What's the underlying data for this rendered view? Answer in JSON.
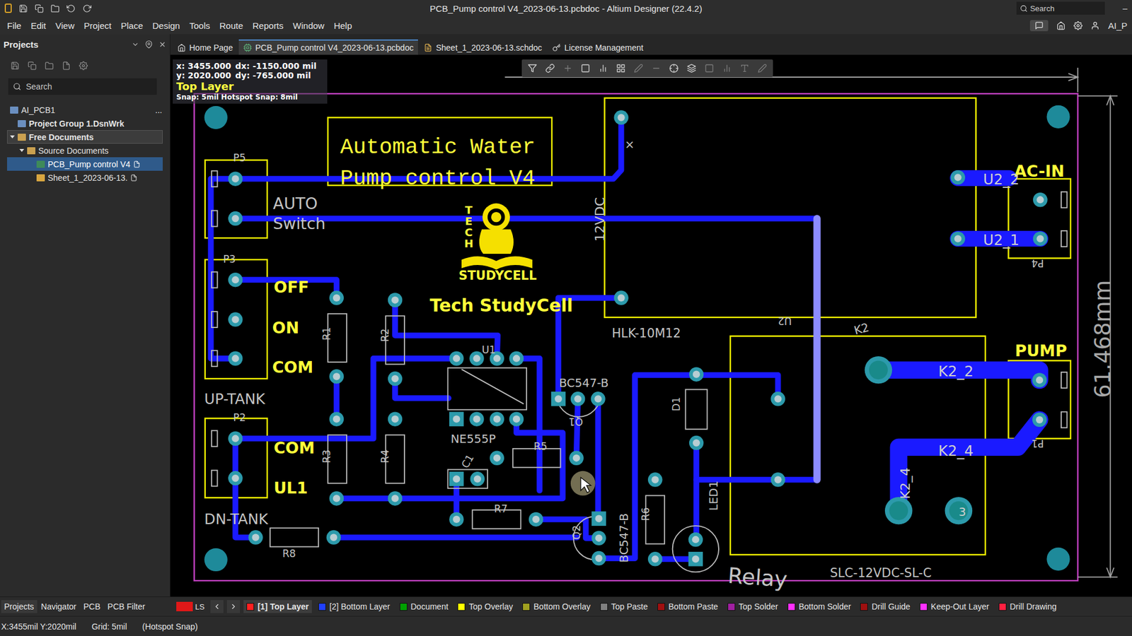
{
  "window": {
    "title": "PCB_Pump control V4_2023-06-13.pcbdoc - Altium Designer (22.4.2)",
    "search_placeholder": "Search",
    "minimize": "–"
  },
  "menu": [
    "File",
    "Edit",
    "View",
    "Project",
    "Place",
    "Design",
    "Tools",
    "Route",
    "Reports",
    "Window",
    "Help"
  ],
  "account": "AI_P",
  "projects_panel": {
    "title": "Projects",
    "search_placeholder": "Search",
    "workspace": "AI_PCB1",
    "more": "...",
    "tree": [
      {
        "label": "Project Group 1.DsnWrk",
        "level": 0,
        "kind": "group",
        "expanded": true,
        "selected": false,
        "focused": false
      },
      {
        "label": "Free Documents",
        "level": 0,
        "kind": "folder",
        "expanded": true,
        "selected": false,
        "focused": true
      },
      {
        "label": "Source Documents",
        "level": 1,
        "kind": "folder",
        "expanded": true,
        "selected": false,
        "focused": false
      },
      {
        "label": "PCB_Pump control V4",
        "level": 2,
        "kind": "pcb",
        "expanded": false,
        "selected": true,
        "focused": false
      },
      {
        "label": "Sheet_1_2023-06-13.",
        "level": 2,
        "kind": "sch",
        "expanded": false,
        "selected": false,
        "focused": false
      }
    ]
  },
  "tabs": [
    {
      "label": "Home Page",
      "kind": "home",
      "selected": false
    },
    {
      "label": "PCB_Pump control V4_2023-06-13.pcbdoc",
      "kind": "pcb",
      "selected": true
    },
    {
      "label": "Sheet_1_2023-06-13.schdoc",
      "kind": "sch",
      "selected": false
    },
    {
      "label": "License Management",
      "kind": "key",
      "selected": false
    }
  ],
  "hud": {
    "x": "x:  3455.000",
    "dx": "dx: -1150.000 mil",
    "y": "y:  2020.000",
    "dy": "dy:  -765.000 mil",
    "layer": "Top Layer",
    "snap": "Snap: 5mil Hotspot Snap: 8mil"
  },
  "board": {
    "labels": [
      {
        "text": "Automatic Water",
        "kind": "title"
      },
      {
        "text": "Pump control V4",
        "kind": "title"
      },
      {
        "text": "P5",
        "kind": "overlay"
      },
      {
        "text": "AUTO",
        "kind": "overlay"
      },
      {
        "text": "Switch",
        "kind": "overlay"
      },
      {
        "text": "P3",
        "kind": "overlay"
      },
      {
        "text": "OFF",
        "kind": "mark"
      },
      {
        "text": "ON",
        "kind": "mark"
      },
      {
        "text": "COM",
        "kind": "mark"
      },
      {
        "text": "UP-TANK",
        "kind": "overlay"
      },
      {
        "text": "P2",
        "kind": "overlay"
      },
      {
        "text": "COM",
        "kind": "mark"
      },
      {
        "text": "UL1",
        "kind": "mark"
      },
      {
        "text": "DN-TANK",
        "kind": "overlay"
      },
      {
        "text": "R8",
        "kind": "overlay"
      },
      {
        "text": "R1",
        "kind": "overlay"
      },
      {
        "text": "R2",
        "kind": "overlay"
      },
      {
        "text": "R3",
        "kind": "overlay"
      },
      {
        "text": "R4",
        "kind": "overlay"
      },
      {
        "text": "U1",
        "kind": "overlay"
      },
      {
        "text": "NE555P",
        "kind": "overlay"
      },
      {
        "text": "C1",
        "kind": "overlay"
      },
      {
        "text": "R5",
        "kind": "overlay"
      },
      {
        "text": "R7",
        "kind": "overlay"
      },
      {
        "text": "BC547-B",
        "kind": "overlay"
      },
      {
        "text": "Q1",
        "kind": "overlay"
      },
      {
        "text": "Q2",
        "kind": "overlay"
      },
      {
        "text": "BC547-B",
        "kind": "overlay"
      },
      {
        "text": "R6",
        "kind": "overlay"
      },
      {
        "text": "D1",
        "kind": "overlay"
      },
      {
        "text": "LED1",
        "kind": "overlay"
      },
      {
        "text": "12VDC",
        "kind": "overlay"
      },
      {
        "text": "HLK-10M12",
        "kind": "overlay"
      },
      {
        "text": "U2",
        "kind": "overlay"
      },
      {
        "text": "K2",
        "kind": "overlay"
      },
      {
        "text": "AC-IN",
        "kind": "mark"
      },
      {
        "text": "P4",
        "kind": "overlay"
      },
      {
        "text": "PUMP",
        "kind": "mark"
      },
      {
        "text": "P1",
        "kind": "overlay"
      },
      {
        "text": "SLC-12VDC-SL-C",
        "kind": "overlay"
      },
      {
        "text": "Relay",
        "kind": "overlay"
      },
      {
        "text": "Tech StudyCell",
        "kind": "mark"
      },
      {
        "text": "STUDYCELL",
        "kind": "mark"
      },
      {
        "text": "61.468mm",
        "kind": "dim"
      },
      {
        "text": "U2_2",
        "kind": "pad"
      },
      {
        "text": "U2_1",
        "kind": "pad"
      },
      {
        "text": "K2_2",
        "kind": "pad"
      },
      {
        "text": "K2_4",
        "kind": "pad"
      },
      {
        "text": "K2_4",
        "kind": "pad"
      },
      {
        "text": "3",
        "kind": "pad"
      },
      {
        "text": "×",
        "kind": "overlay"
      },
      {
        "text": "TECH",
        "kind": "vertical"
      }
    ]
  },
  "panel_tabs": [
    {
      "label": "Projects",
      "selected": true
    },
    {
      "label": "Navigator",
      "selected": false
    },
    {
      "label": "PCB",
      "selected": false
    },
    {
      "label": "PCB Filter",
      "selected": false
    }
  ],
  "layer_set": "LS",
  "layers": [
    {
      "label": "[1] Top Layer",
      "color": "#ff2020",
      "selected": true
    },
    {
      "label": "[2] Bottom Layer",
      "color": "#2040ff",
      "selected": false
    },
    {
      "label": "Document",
      "color": "#00a000",
      "selected": false
    },
    {
      "label": "Top Overlay",
      "color": "#ffff00",
      "selected": false
    },
    {
      "label": "Bottom Overlay",
      "color": "#a0a020",
      "selected": false
    },
    {
      "label": "Top Paste",
      "color": "#808080",
      "selected": false
    },
    {
      "label": "Bottom Paste",
      "color": "#a01010",
      "selected": false
    },
    {
      "label": "Top Solder",
      "color": "#a020a0",
      "selected": false
    },
    {
      "label": "Bottom Solder",
      "color": "#ff30ff",
      "selected": false
    },
    {
      "label": "Drill Guide",
      "color": "#a01010",
      "selected": false
    },
    {
      "label": "Keep-Out Layer",
      "color": "#ff30ff",
      "selected": false
    },
    {
      "label": "Drill Drawing",
      "color": "#ff2040",
      "selected": false
    }
  ],
  "status_bar": {
    "position": "X:3455mil Y:2020mil",
    "grid": "Grid: 5mil",
    "snap": "(Hotspot Snap)"
  }
}
